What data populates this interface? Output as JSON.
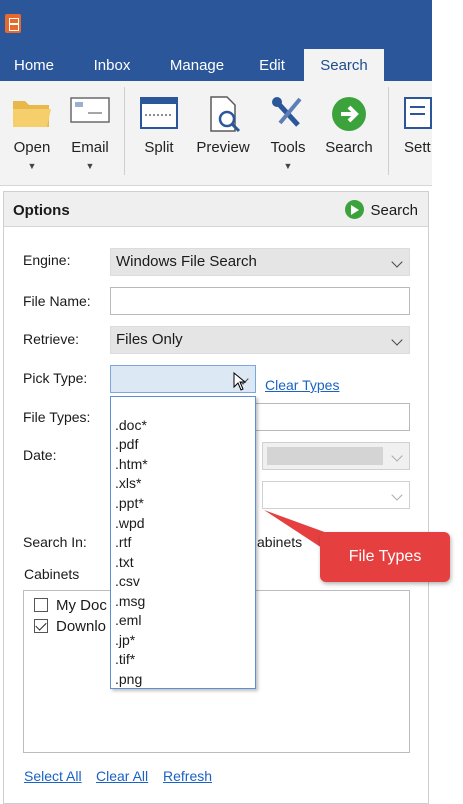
{
  "ribbon_tabs": {
    "home": "Home",
    "inbox": "Inbox",
    "manage": "Manage",
    "edit": "Edit",
    "search": "Search"
  },
  "ribbon_buttons": {
    "open": "Open",
    "email": "Email",
    "split": "Split",
    "preview": "Preview",
    "tools": "Tools",
    "search": "Search",
    "settings_partial": "Sett"
  },
  "options": {
    "title": "Options",
    "search_button": "Search",
    "engine_label": "Engine:",
    "engine_value": "Windows File Search",
    "file_name_label": "File Name:",
    "file_name_value": "",
    "retrieve_label": "Retrieve:",
    "retrieve_value": "Files Only",
    "pick_type_label": "Pick Type:",
    "pick_type_value": "",
    "clear_types": "Clear Types",
    "file_types_label": "File Types:",
    "file_types_value": "",
    "date_label": "Date:",
    "search_in_label": "Search In:",
    "search_in_partial": "abinets",
    "cabinets_label": "Cabinets",
    "cabinets": [
      {
        "label": "My Doc",
        "checked": false
      },
      {
        "label": "Downlo",
        "checked": true
      }
    ],
    "select_all": "Select All",
    "clear_all": "Clear All",
    "refresh": "Refresh"
  },
  "pick_type_options": [
    ".doc*",
    ".pdf",
    ".htm*",
    ".xls*",
    ".ppt*",
    ".wpd",
    ".rtf",
    ".txt",
    ".csv",
    ".msg",
    ".eml",
    ".jp*",
    ".tif*",
    ".png"
  ],
  "callout": "File Types",
  "colors": {
    "accent": "#2b579a",
    "callout": "#e5403f",
    "link": "#1a62c4",
    "go": "#3ca33c"
  }
}
